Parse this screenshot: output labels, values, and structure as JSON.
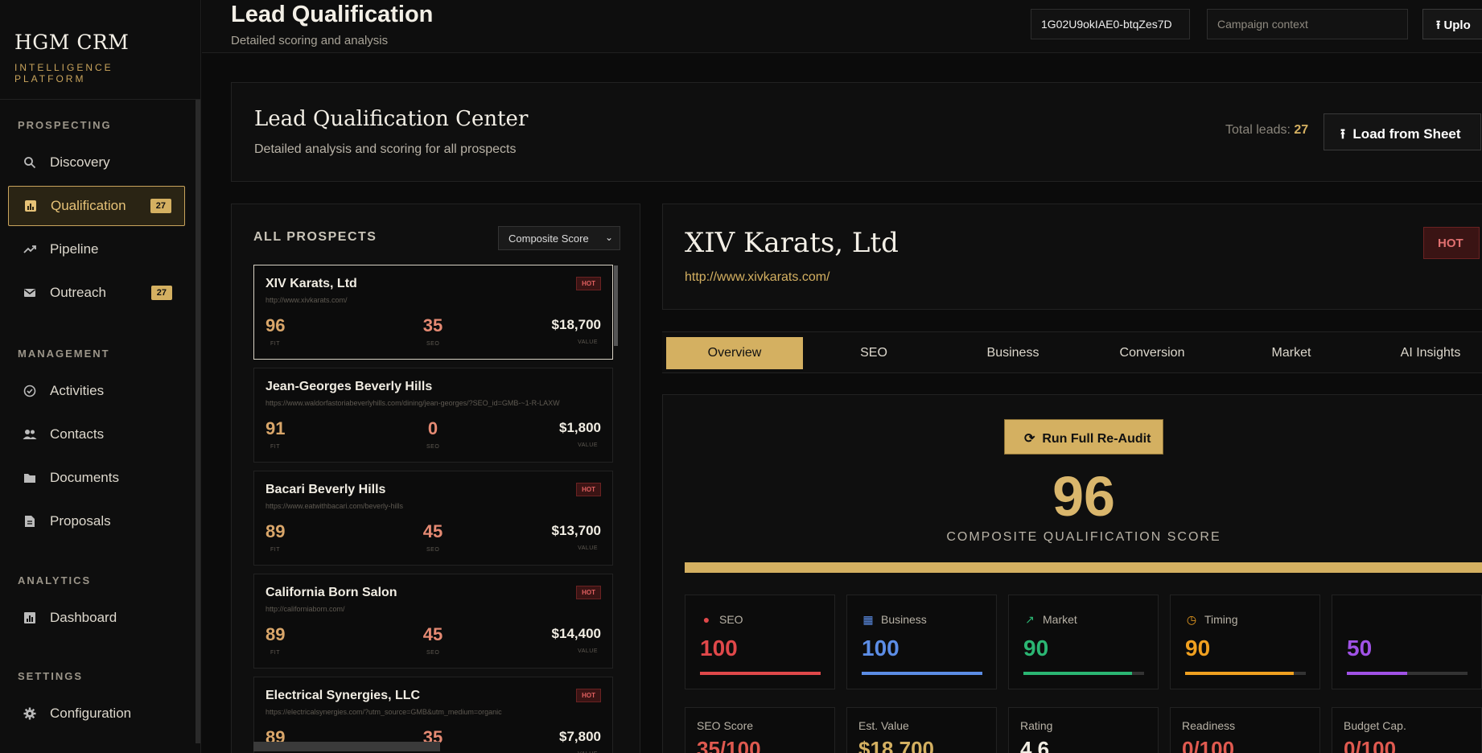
{
  "brand": {
    "name": "HGM CRM",
    "subtitle": "INTELLIGENCE PLATFORM"
  },
  "sidebar": {
    "sections": [
      {
        "heading": "PROSPECTING"
      },
      {
        "heading": "MANAGEMENT"
      },
      {
        "heading": "ANALYTICS"
      },
      {
        "heading": "SETTINGS"
      }
    ],
    "items": [
      {
        "label": "Discovery",
        "icon": "search-icon"
      },
      {
        "label": "Qualification",
        "icon": "bar-chart-icon",
        "badge": "27",
        "active": true
      },
      {
        "label": "Pipeline",
        "icon": "trend-icon"
      },
      {
        "label": "Outreach",
        "icon": "mail-icon",
        "badge": "27"
      },
      {
        "label": "Activities",
        "icon": "check-circle-icon"
      },
      {
        "label": "Contacts",
        "icon": "people-icon"
      },
      {
        "label": "Documents",
        "icon": "folder-icon"
      },
      {
        "label": "Proposals",
        "icon": "document-icon"
      },
      {
        "label": "Dashboard",
        "icon": "dashboard-icon"
      },
      {
        "label": "Configuration",
        "icon": "gear-icon"
      }
    ]
  },
  "topbar": {
    "title": "Lead Qualification",
    "subtitle": "Detailed scoring and analysis",
    "sheet_id": "1G02U9okIAE0-btqZes7D",
    "campaign_placeholder": "Campaign context",
    "upload_label": "Uplo"
  },
  "header": {
    "title": "Lead Qualification Center",
    "subtitle": "Detailed analysis and scoring for all prospects",
    "total_label": "Total leads:",
    "total_value": "27",
    "load_label": "Load from Sheet"
  },
  "list": {
    "title": "ALL PROSPECTS",
    "sort_value": "Composite Score",
    "fit_label": "FIT",
    "seo_label": "SEO",
    "value_label": "VALUE",
    "hot_label": "HOT",
    "prospects": [
      {
        "name": "XIV Karats, Ltd",
        "url": "http://www.xivkarats.com/",
        "fit": "96",
        "seo": "35",
        "value": "$18,700",
        "hot": true
      },
      {
        "name": "Jean-Georges Beverly Hills",
        "url": "https://www.waldorfastoriabeverlyhills.com/dining/jean-georges/?SEO_id=GMB-~1-R-LAXW",
        "fit": "91",
        "seo": "0",
        "value": "$1,800",
        "hot": false
      },
      {
        "name": "Bacari Beverly Hills",
        "url": "https://www.eatwithbacari.com/beverly-hills",
        "fit": "89",
        "seo": "45",
        "value": "$13,700",
        "hot": true
      },
      {
        "name": "California Born Salon",
        "url": "http://californiaborn.com/",
        "fit": "89",
        "seo": "45",
        "value": "$14,400",
        "hot": true
      },
      {
        "name": "Electrical Synergies, LLC",
        "url": "https://electricalsynergies.com/?utm_source=GMB&utm_medium=organic",
        "fit": "89",
        "seo": "35",
        "value": "$7,800",
        "hot": true
      }
    ]
  },
  "detail": {
    "name": "XIV Karats, Ltd",
    "url": "http://www.xivkarats.com/",
    "hot_label": "HOT",
    "tabs": [
      "Overview",
      "SEO",
      "Business",
      "Conversion",
      "Market",
      "AI Insights"
    ],
    "reaudit_label": "Run Full Re-Audit",
    "composite_score": "96",
    "composite_label": "COMPOSITE QUALIFICATION SCORE",
    "composite_fraction": 0.96,
    "metrics": [
      {
        "label": "SEO",
        "value": "100",
        "color": "#e0484a",
        "icon": "alert-icon",
        "fraction": 1.0
      },
      {
        "label": "Business",
        "value": "100",
        "color": "#5c8de6",
        "icon": "building-icon",
        "fraction": 1.0
      },
      {
        "label": "Market",
        "value": "90",
        "color": "#2bb673",
        "icon": "trend-icon",
        "fraction": 0.9
      },
      {
        "label": "Timing",
        "value": "90",
        "color": "#f0a020",
        "icon": "clock-icon",
        "fraction": 0.9
      },
      {
        "label": "",
        "value": "50",
        "color": "#a052e6",
        "icon": "",
        "fraction": 0.5
      }
    ],
    "stats": [
      {
        "label": "SEO Score",
        "value": "35/100",
        "color": "#e05a50"
      },
      {
        "label": "Est. Value",
        "value": "$18,700",
        "color": "#d4b061"
      },
      {
        "label": "Rating",
        "value": "4.6",
        "color": "#f1ede3"
      },
      {
        "label": "Readiness",
        "value": "0/100",
        "color": "#e05a50"
      },
      {
        "label": "Budget Cap.",
        "value": "0/100",
        "color": "#e05a50"
      }
    ]
  }
}
